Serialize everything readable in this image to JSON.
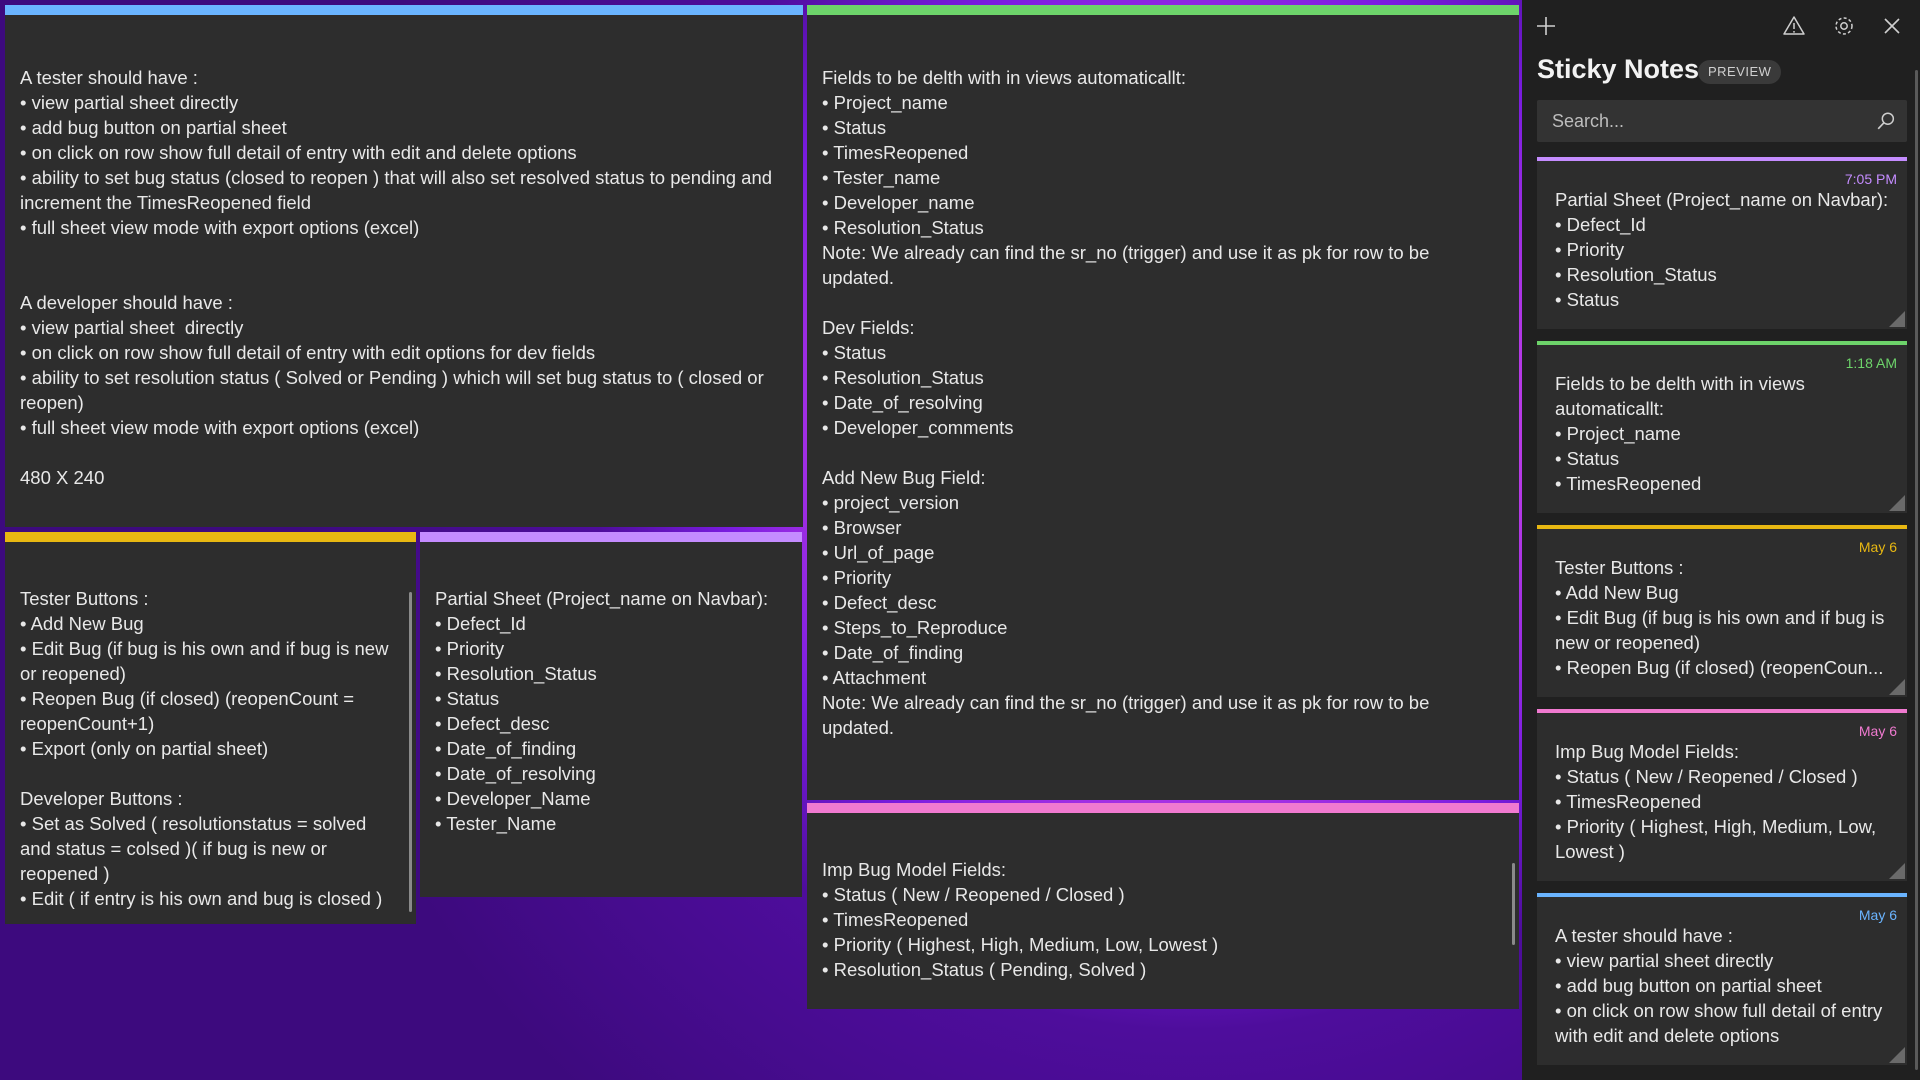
{
  "colors": {
    "blue": "#6ab4ff",
    "green": "#6dd36a",
    "yellow": "#e8b812",
    "purple": "#c48cff",
    "pink": "#f07ad0",
    "note_bg": "#2d2d2d",
    "panel_bg": "#202020"
  },
  "notes": {
    "tester": "A tester should have :\n• view partial sheet directly\n• add bug button on partial sheet\n• on click on row show full detail of entry with edit and delete options\n• ability to set bug status (closed to reopen ) that will also set resolved status to pending and increment the TimesReopened field\n• full sheet view mode with export options (excel)\n\n\nA developer should have :\n• view partial sheet  directly\n• on click on row show full detail of entry with edit options for dev fields\n• ability to set resolution status ( Solved or Pending ) which will set bug status to ( closed or reopen)\n• full sheet view mode with export options (excel)\n\n480 X 240",
    "fields": "Fields to be delth with in views automaticallt:\n• Project_name\n• Status\n• TimesReopened\n• Tester_name\n• Developer_name\n• Resolution_Status\nNote: We already can find the sr_no (trigger) and use it as pk for row to be updated.\n\nDev Fields:\n• Status\n• Resolution_Status\n• Date_of_resolving\n• Developer_comments\n\nAdd New Bug Field:\n• project_version\n• Browser\n• Url_of_page\n• Priority\n• Defect_desc\n• Steps_to_Reproduce\n• Date_of_finding\n• Attachment\nNote: We already can find the sr_no (trigger) and use it as pk for row to be updated.",
    "buttons": "Tester Buttons :\n• Add New Bug\n• Edit Bug (if bug is his own and if bug is new or reopened)\n• Reopen Bug (if closed) (reopenCount = reopenCount+1)\n• Export (only on partial sheet)\n\nDeveloper Buttons :\n• Set as Solved ( resolutionstatus = solved and status = colsed )( if bug is new or reopened )\n• Edit ( if entry is his own and bug is closed )",
    "partial": "Partial Sheet (Project_name on Navbar):\n• Defect_Id\n• Priority\n• Resolution_Status\n• Status\n• Defect_desc\n• Date_of_finding\n• Date_of_resolving\n• Developer_Name\n• Tester_Name",
    "imp": "Imp Bug Model Fields:\n• Status ( New / Reopened / Closed )\n• TimesReopened\n• Priority ( Highest, High, Medium, Low, Lowest )\n• Resolution_Status ( Pending, Solved )"
  },
  "panel": {
    "title": "Sticky Notes",
    "badge": "PREVIEW",
    "search_placeholder": "Search...",
    "cards": [
      {
        "time": "7:05 PM",
        "text": "Partial Sheet (Project_name on Navbar):\n• Defect_Id\n• Priority\n• Resolution_Status\n• Status"
      },
      {
        "time": "1:18 AM",
        "text": "Fields to be delth with in views automaticallt:\n• Project_name\n• Status\n• TimesReopened"
      },
      {
        "time": "May 6",
        "text": "Tester Buttons :\n• Add New Bug\n• Edit Bug (if bug is his own and if bug is new or reopened)\n• Reopen Bug (if closed) (reopenCoun..."
      },
      {
        "time": "May 6",
        "text": "Imp Bug Model Fields:\n• Status ( New / Reopened / Closed )\n• TimesReopened\n• Priority ( Highest, High, Medium, Low, Lowest )"
      },
      {
        "time": "May 6",
        "text": "A tester should have :\n• view partial sheet directly\n• add bug button on partial sheet\n• on click on row show full detail of entry with edit and delete options"
      }
    ]
  }
}
